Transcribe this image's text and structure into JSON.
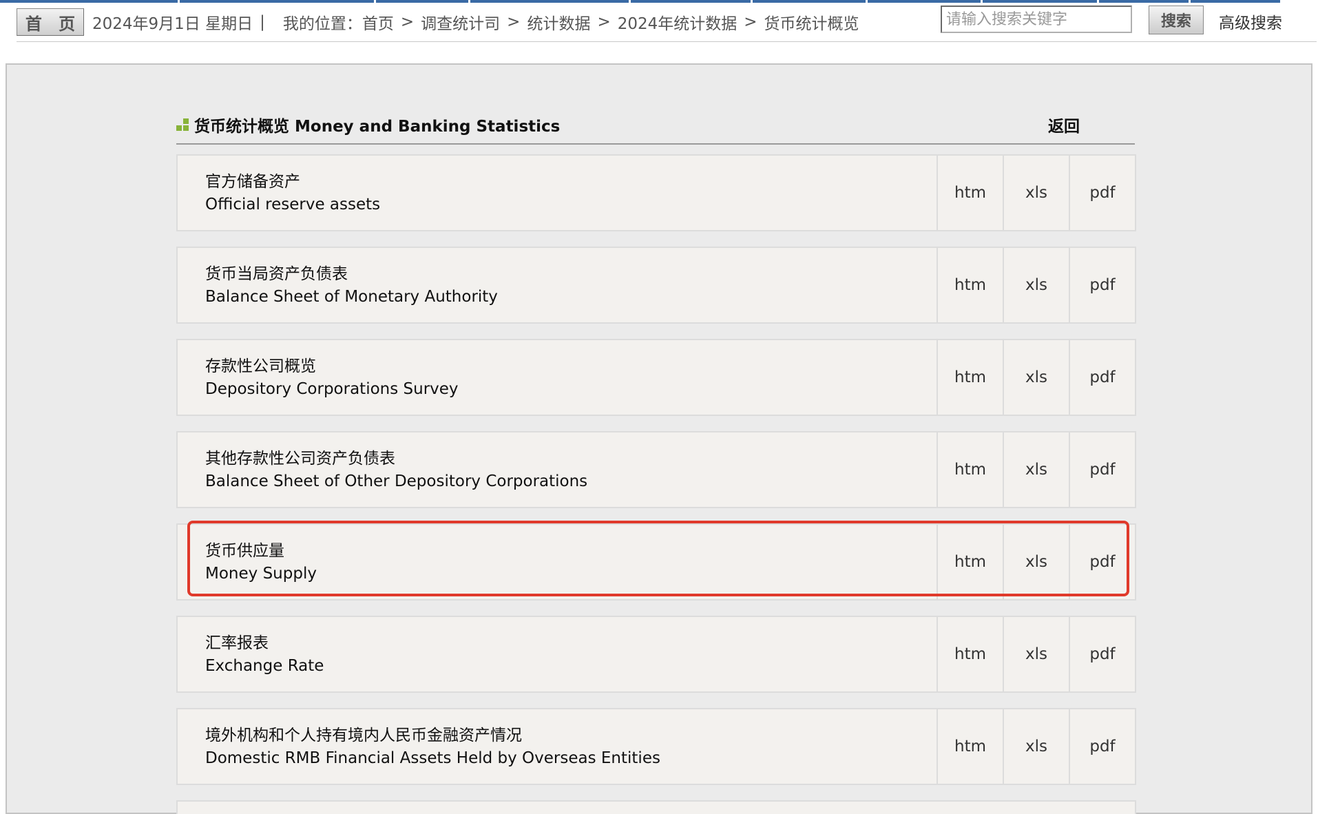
{
  "header": {
    "home_label": "首 页",
    "date": "2024年9月1日 星期日",
    "separator": "|",
    "location_label": "我的位置：",
    "breadcrumb": [
      "首页",
      "调查统计司",
      "统计数据",
      "2024年统计数据",
      "货币统计概览"
    ],
    "search_placeholder": "请输入搜索关键字",
    "search_button": "搜索",
    "advanced_search": "高级搜索"
  },
  "section": {
    "title": "货币统计概览 Money and Banking Statistics",
    "back_label": "返回"
  },
  "rows": [
    {
      "zh": "官方储备资产",
      "en": "Official reserve assets",
      "htm": "htm",
      "xls": "xls",
      "pdf": "pdf"
    },
    {
      "zh": "货币当局资产负债表",
      "en": "Balance Sheet of Monetary Authority",
      "htm": "htm",
      "xls": "xls",
      "pdf": "pdf"
    },
    {
      "zh": "存款性公司概览",
      "en": "Depository Corporations Survey",
      "htm": "htm",
      "xls": "xls",
      "pdf": "pdf"
    },
    {
      "zh": "其他存款性公司资产负债表",
      "en": "Balance Sheet of Other Depository Corporations",
      "htm": "htm",
      "xls": "xls",
      "pdf": "pdf"
    },
    {
      "zh": "货币供应量",
      "en": "Money Supply",
      "htm": "htm",
      "xls": "xls",
      "pdf": "pdf",
      "highlighted": true
    },
    {
      "zh": "汇率报表",
      "en": "Exchange Rate",
      "htm": "htm",
      "xls": "xls",
      "pdf": "pdf"
    },
    {
      "zh": "境外机构和个人持有境内人民币金融资产情况",
      "en": "Domestic RMB Financial Assets Held by Overseas Entities",
      "htm": "htm",
      "xls": "xls",
      "pdf": "pdf"
    }
  ],
  "colors": {
    "accent_blue": "#3a6aa5",
    "highlight_red": "#e03a2b",
    "icon_green": "#88b33a",
    "row_background": "#f3f1ee",
    "panel_background": "#ebebeb"
  },
  "icons": {
    "title_icon": "green-squares-icon"
  }
}
